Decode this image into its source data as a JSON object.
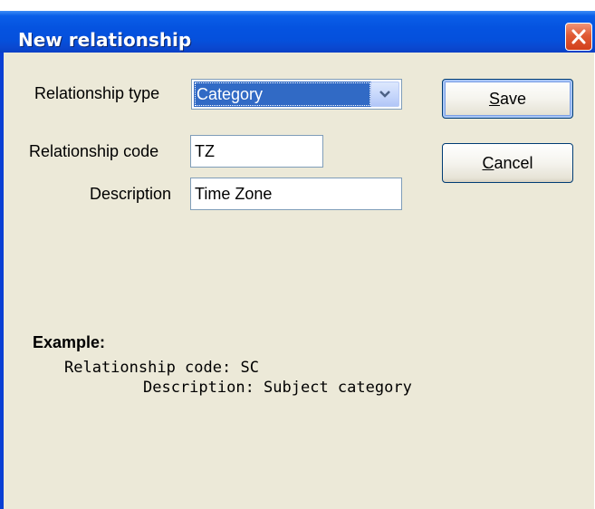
{
  "window": {
    "title": "New relationship",
    "close_icon": "close-icon"
  },
  "form": {
    "relationship_type": {
      "label": "Relationship type",
      "value": "Category"
    },
    "relationship_code": {
      "label": "Relationship code",
      "value": "TZ"
    },
    "description": {
      "label": "Description",
      "value": "Time Zone"
    }
  },
  "buttons": {
    "save": {
      "mnemonic": "S",
      "rest": "ave"
    },
    "cancel": {
      "mnemonic": "C",
      "rest": "ancel"
    }
  },
  "example": {
    "heading": "Example:",
    "code_line": "Relationship code: SC",
    "description_line": "Description: Subject category"
  },
  "colors": {
    "title_bar": "#0553e0",
    "dialog_bg": "#ece9d8",
    "selection": "#316ac5",
    "close_button": "#e05a34"
  }
}
